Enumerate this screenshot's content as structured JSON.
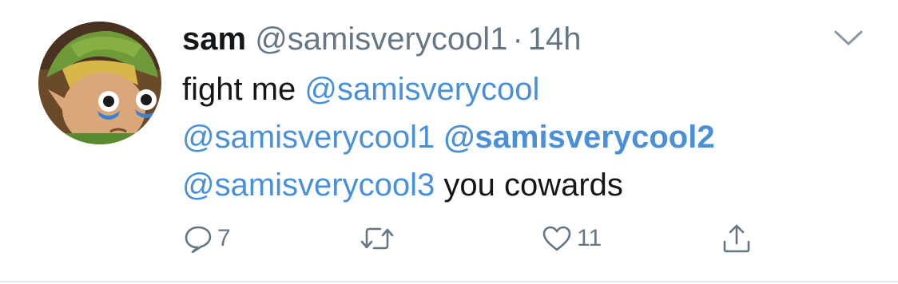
{
  "tweet": {
    "display_name": "sam",
    "handle": "@samisverycool1",
    "separator": "·",
    "time": "14h",
    "body": {
      "line1_text": "fight me ",
      "line1_mention": "@samisverycool",
      "line2_mention1": "@samisverycool1",
      "line2_mention2": "@samisverycool2",
      "line3_mention": "@samisverycool3",
      "line3_text": " you cowards"
    },
    "actions": {
      "reply_count": "7",
      "retweet_count": "",
      "like_count": "11"
    }
  },
  "icons": {
    "avatar": "avatar-image",
    "caret": "chevron-down-icon",
    "reply": "reply-icon",
    "retweet": "retweet-icon",
    "like": "heart-icon",
    "share": "share-icon"
  },
  "colors": {
    "link": "#4a90d9",
    "text": "#14171a",
    "muted": "#657786"
  }
}
